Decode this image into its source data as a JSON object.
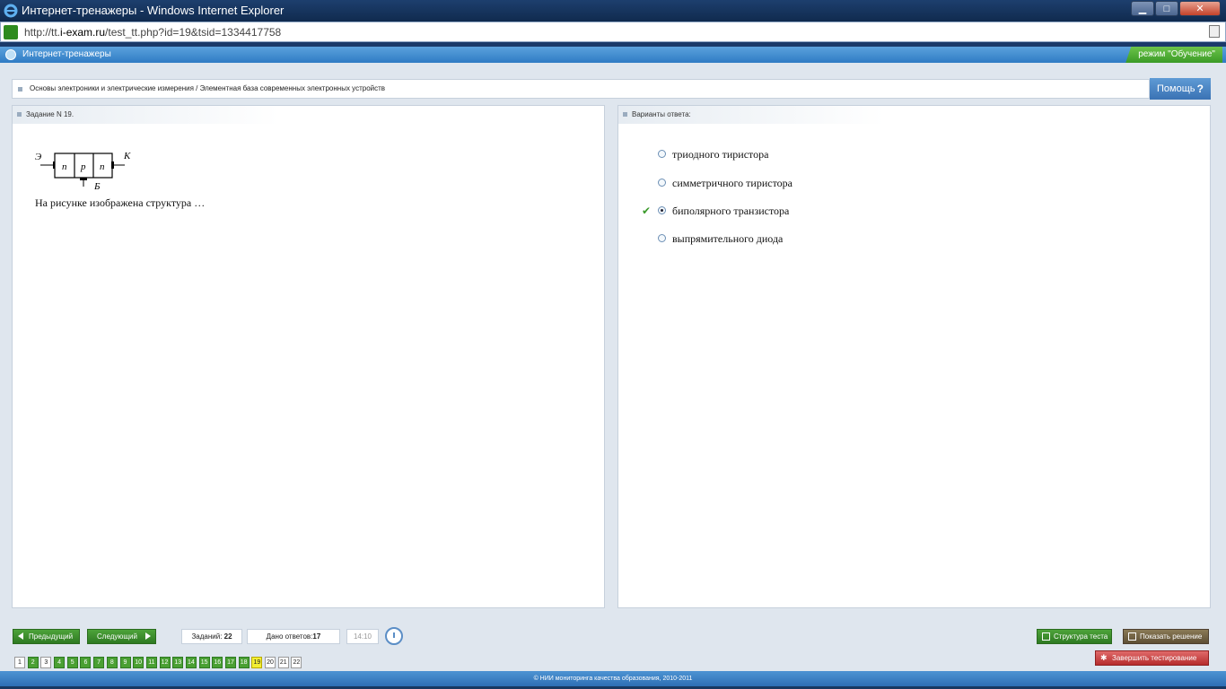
{
  "window": {
    "title": "Интернет-тренажеры - Windows Internet Explorer",
    "url_prefix": "http://tt.",
    "url_domain": "i-exam.ru",
    "url_path": "/test_tt.php?id=19&tsid=1334417758"
  },
  "app": {
    "title": "Интернет-тренажеры",
    "mode_label": "режим \"Обучение\""
  },
  "breadcrumb": "Основы электроники и электрические измерения / Элементная база современных электронных устройств",
  "help_label": "Помощь",
  "help_icon": "?",
  "task": {
    "header": "Задание N 19.",
    "diagram_labels": {
      "emitter": "Э",
      "collector": "К",
      "base": "Б",
      "layer1": "n",
      "layer2": "p",
      "layer3": "n"
    },
    "question": "На рисунке изображена структура …"
  },
  "answers": {
    "header": "Варианты ответа:",
    "check_icon": "✔",
    "options": [
      {
        "text": "триодного тиристора",
        "selected": false,
        "correct": false
      },
      {
        "text": "симметричного тиристора",
        "selected": false,
        "correct": false
      },
      {
        "text": "биполярного транзистора",
        "selected": true,
        "correct": true
      },
      {
        "text": "выпрямительного диода",
        "selected": false,
        "correct": false
      }
    ]
  },
  "toolbar": {
    "prev_label": "Предыдущий",
    "next_label": "Следующий",
    "tasks_label": "Заданий:",
    "tasks_count": "22",
    "answered_label": "Дано ответов:",
    "answered_count": "17",
    "timer": "14:10",
    "structure_label": "Структура теста",
    "solution_label": "Показать решение",
    "finish_label": "Завершить тестирование"
  },
  "pages": [
    {
      "n": "1",
      "state": "unanswered"
    },
    {
      "n": "2",
      "state": "answered"
    },
    {
      "n": "3",
      "state": "unanswered"
    },
    {
      "n": "4",
      "state": "answered"
    },
    {
      "n": "5",
      "state": "answered"
    },
    {
      "n": "6",
      "state": "answered"
    },
    {
      "n": "7",
      "state": "answered"
    },
    {
      "n": "8",
      "state": "answered"
    },
    {
      "n": "9",
      "state": "answered"
    },
    {
      "n": "10",
      "state": "answered"
    },
    {
      "n": "11",
      "state": "answered"
    },
    {
      "n": "12",
      "state": "answered"
    },
    {
      "n": "13",
      "state": "answered"
    },
    {
      "n": "14",
      "state": "answered"
    },
    {
      "n": "15",
      "state": "answered"
    },
    {
      "n": "16",
      "state": "answered"
    },
    {
      "n": "17",
      "state": "answered"
    },
    {
      "n": "18",
      "state": "answered"
    },
    {
      "n": "19",
      "state": "current"
    },
    {
      "n": "20",
      "state": "unanswered"
    },
    {
      "n": "21",
      "state": "unanswered"
    },
    {
      "n": "22",
      "state": "unanswered"
    }
  ],
  "footer": "© НИИ мониторинга качества образования, 2010-2011"
}
